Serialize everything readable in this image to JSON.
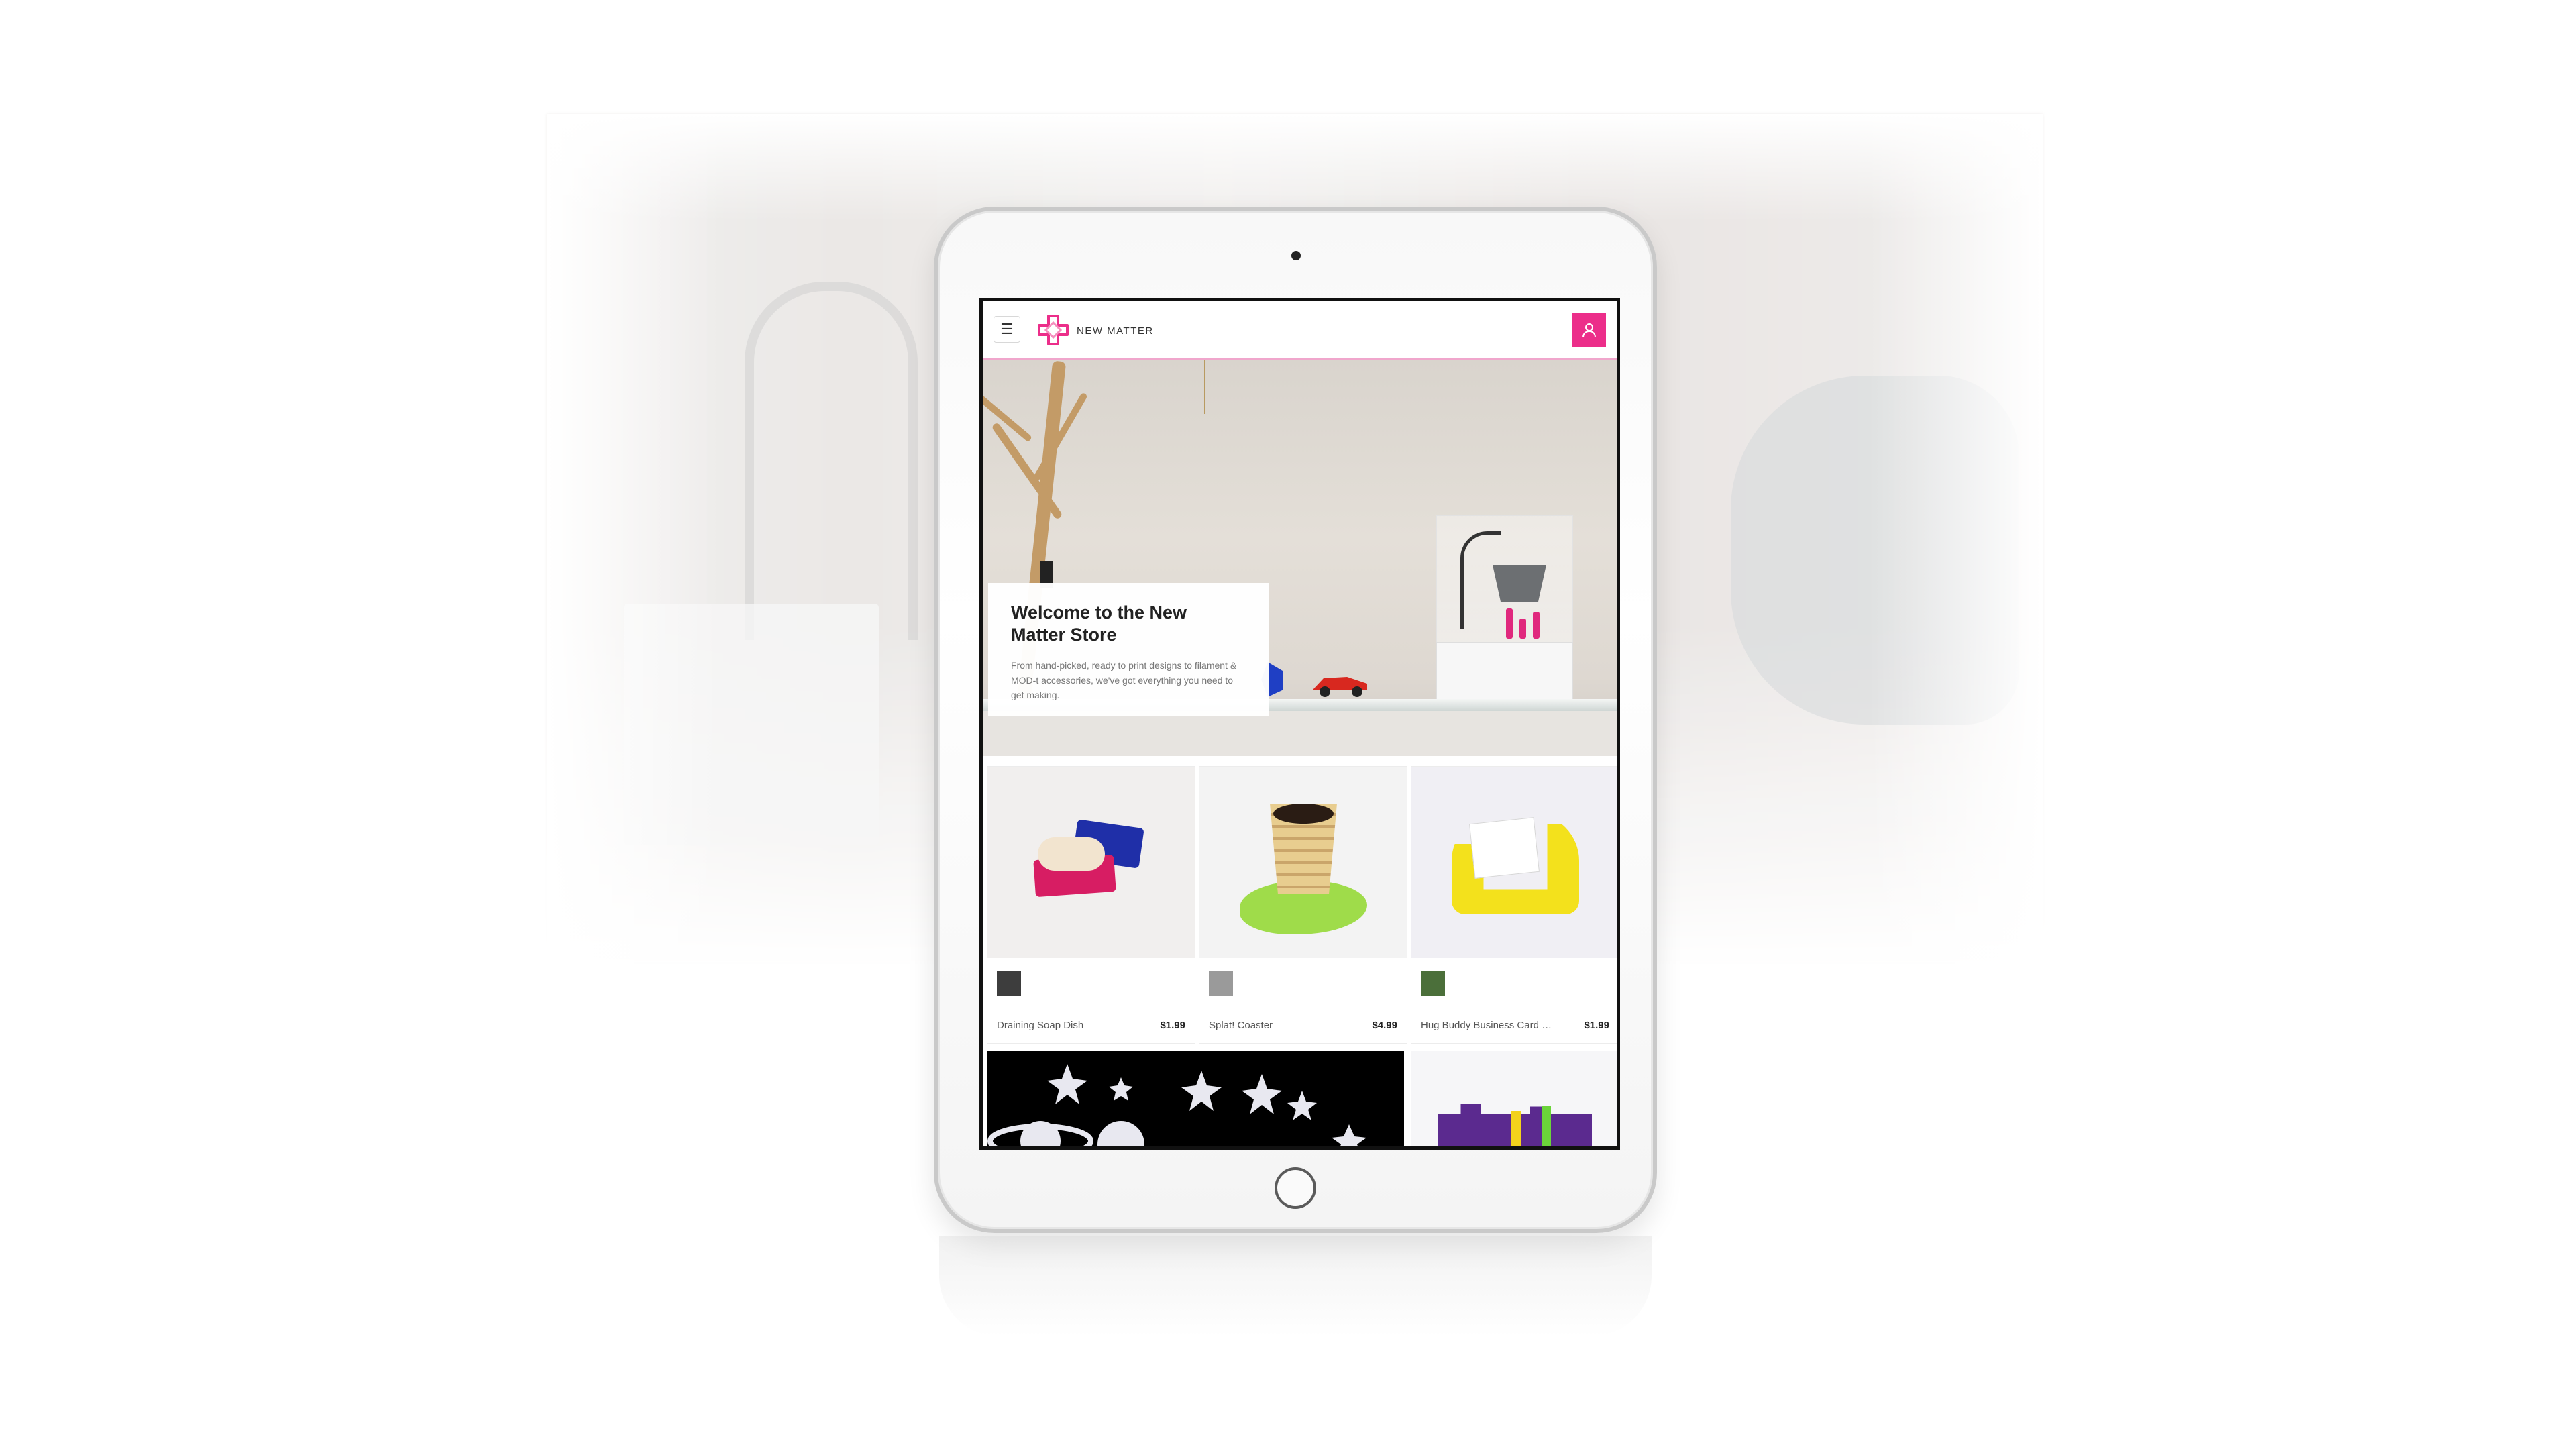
{
  "brand": {
    "name": "NEW MATTER",
    "accent": "#ec2e8a"
  },
  "topbar": {
    "menu_icon": "hamburger-icon",
    "user_icon": "user-icon"
  },
  "hero": {
    "title": "Welcome to the New Matter Store",
    "subtitle": "From hand-picked, ready to print designs to filament & MOD-t accessories, we've got everything you need to get making."
  },
  "products": [
    {
      "name": "Draining Soap Dish",
      "price": "$1.99"
    },
    {
      "name": "Splat! Coaster",
      "price": "$4.99"
    },
    {
      "name": "Hug Buddy Business Card Holder",
      "price": "$1.99"
    }
  ]
}
